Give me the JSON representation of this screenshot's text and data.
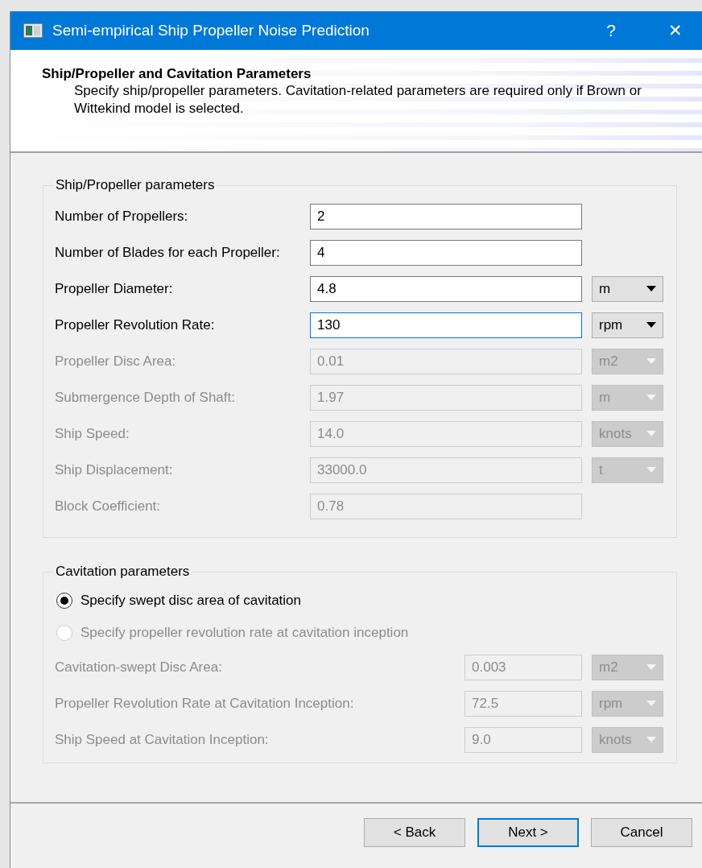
{
  "window": {
    "title": "Semi-empirical Ship Propeller Noise Prediction",
    "help": "?",
    "close": "✕"
  },
  "header": {
    "title": "Ship/Propeller and Cavitation Parameters",
    "description": "Specify ship/propeller parameters. Cavitation-related parameters are required only if Brown or Wittekind model is selected."
  },
  "ship_group": {
    "title": "Ship/Propeller parameters",
    "fields": [
      {
        "label": "Number of Propellers:",
        "value": "2",
        "disabled": false,
        "focused": false
      },
      {
        "label": "Number of Blades for each Propeller:",
        "value": "4",
        "disabled": false,
        "focused": false
      },
      {
        "label": "Propeller Diameter:",
        "value": "4.8",
        "unit": "m",
        "disabled": false,
        "focused": false
      },
      {
        "label": "Propeller Revolution Rate:",
        "value": "130",
        "unit": "rpm",
        "disabled": false,
        "focused": true
      },
      {
        "label": "Propeller Disc Area:",
        "value": "0.01",
        "unit": "m2",
        "disabled": true,
        "focused": false
      },
      {
        "label": "Submergence Depth of Shaft:",
        "value": "1.97",
        "unit": "m",
        "disabled": true,
        "focused": false
      },
      {
        "label": "Ship Speed:",
        "value": "14.0",
        "unit": "knots",
        "disabled": true,
        "focused": false
      },
      {
        "label": "Ship Displacement:",
        "value": "33000.0",
        "unit": "t",
        "disabled": true,
        "focused": false
      },
      {
        "label": "Block Coefficient:",
        "value": "0.78",
        "disabled": true,
        "focused": false
      }
    ]
  },
  "cavitation_group": {
    "title": "Cavitation parameters",
    "options": [
      {
        "label": "Specify swept disc area of cavitation",
        "selected": true,
        "disabled": false
      },
      {
        "label": "Specify propeller revolution rate at cavitation inception",
        "selected": false,
        "disabled": true
      }
    ],
    "fields": [
      {
        "label": "Cavitation-swept Disc Area:",
        "value": "0.003",
        "unit": "m2",
        "disabled": true,
        "focused": false
      },
      {
        "label": "Propeller Revolution Rate at Cavitation Inception:",
        "value": "72.5",
        "unit": "rpm",
        "disabled": true,
        "focused": false
      },
      {
        "label": "Ship Speed at Cavitation Inception:",
        "value": "9.0",
        "unit": "knots",
        "disabled": true,
        "focused": false
      }
    ]
  },
  "buttons": [
    {
      "label": "< Back",
      "default": false
    },
    {
      "label": "Next >",
      "default": true
    },
    {
      "label": "Cancel",
      "default": false
    }
  ]
}
